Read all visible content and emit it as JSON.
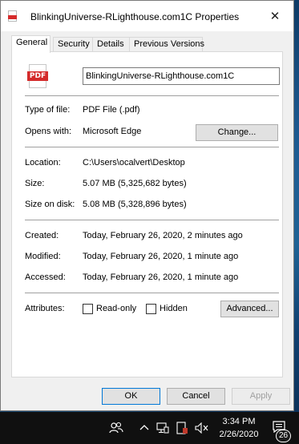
{
  "window": {
    "title": "BlinkingUniverse-RLighthouse.com1C Properties",
    "close_glyph": "✕",
    "title_icon": "pdf-file-icon"
  },
  "tabs": [
    {
      "label": "General",
      "active": true
    },
    {
      "label": "Security",
      "active": false
    },
    {
      "label": "Details",
      "active": false
    },
    {
      "label": "Previous Versions",
      "active": false
    }
  ],
  "general": {
    "file_icon": "pdf-file-icon",
    "file_icon_text": "PDF",
    "file_name": "BlinkingUniverse-RLighthouse.com1C",
    "type_of_file_label": "Type of file:",
    "type_of_file": "PDF File (.pdf)",
    "opens_with_label": "Opens with:",
    "opens_with": "Microsoft Edge",
    "change_button": "Change...",
    "location_label": "Location:",
    "location": "C:\\Users\\ocalvert\\Desktop",
    "size_label": "Size:",
    "size": "5.07 MB (5,325,682 bytes)",
    "size_on_disk_label": "Size on disk:",
    "size_on_disk": "5.08 MB (5,328,896 bytes)",
    "created_label": "Created:",
    "created": "Today, February 26, 2020, 2 minutes ago",
    "modified_label": "Modified:",
    "modified": "Today, February 26, 2020, 1 minute ago",
    "accessed_label": "Accessed:",
    "accessed": "Today, February 26, 2020, 1 minute ago",
    "attributes_label": "Attributes:",
    "readonly_label": "Read-only",
    "readonly_checked": false,
    "hidden_label": "Hidden",
    "hidden_checked": false,
    "advanced_button": "Advanced..."
  },
  "footer": {
    "ok": "OK",
    "cancel": "Cancel",
    "apply": "Apply",
    "apply_enabled": false
  },
  "taskbar": {
    "time": "3:34 PM",
    "date": "2/26/2020",
    "notification_count": "26",
    "icons": [
      "people-icon",
      "chevron-up-icon",
      "network-icon",
      "battery-icon",
      "volume-muted-icon",
      "action-center-icon"
    ]
  }
}
